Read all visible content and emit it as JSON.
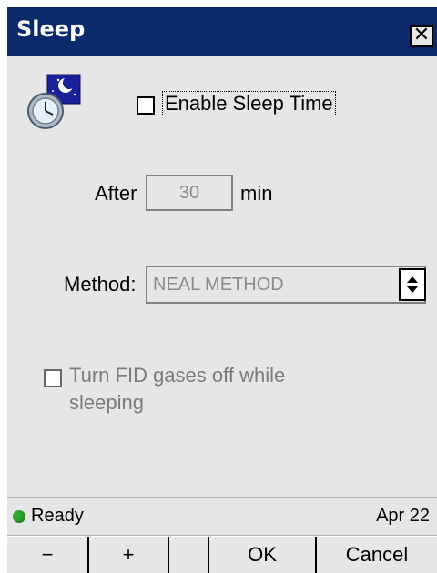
{
  "window": {
    "title": "Sleep",
    "close_glyph": "✕"
  },
  "icon": {
    "name": "sleep-clock-icon"
  },
  "enable_sleep": {
    "label": "Enable Sleep Time",
    "checked": false
  },
  "after": {
    "label": "After",
    "value": "30",
    "unit": "min"
  },
  "method": {
    "label": "Method:",
    "value": "NEAL METHOD"
  },
  "fid_gases": {
    "line1": "Turn FID gases off while",
    "line2": "sleeping",
    "checked": false
  },
  "status": {
    "text": "Ready",
    "date": "Apr 22",
    "indicator_color": "#2fa82f"
  },
  "buttons": {
    "minus": "−",
    "plus": "+",
    "ok": "OK",
    "cancel": "Cancel"
  },
  "colors": {
    "titlebar": "#0b2a6b",
    "panel": "#e6e6e6"
  }
}
